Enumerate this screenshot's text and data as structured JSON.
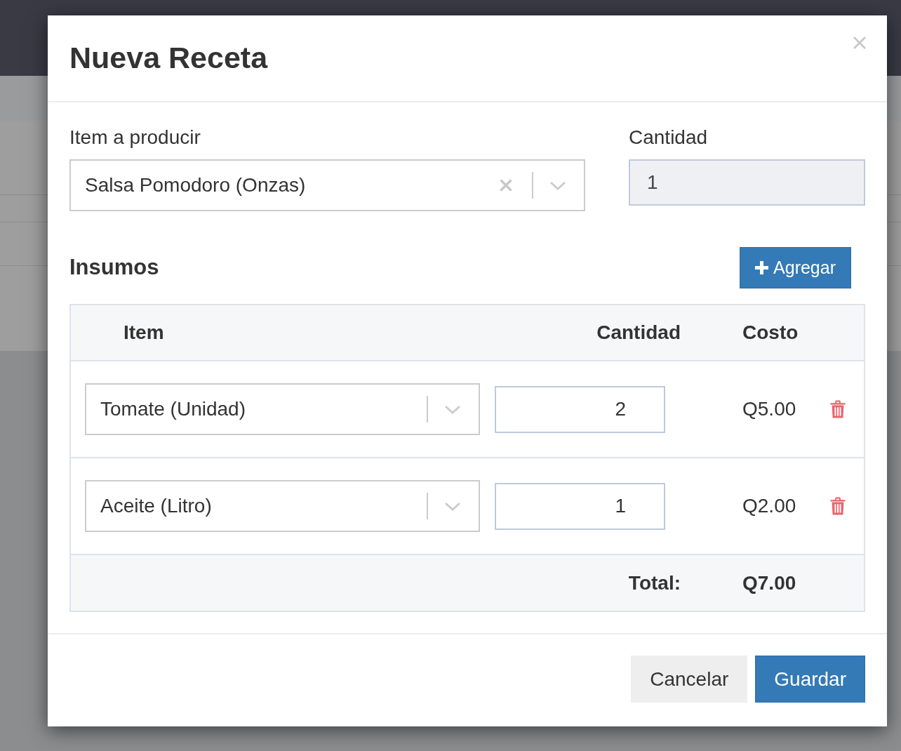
{
  "modal": {
    "title": "Nueva Receta"
  },
  "product": {
    "label": "Item a producir",
    "value": "Salsa Pomodoro (Onzas)",
    "clearable": true
  },
  "quantity": {
    "label": "Cantidad",
    "value": "1",
    "readonly": true
  },
  "ingredients": {
    "title": "Insumos",
    "add_button": "Agregar",
    "columns": [
      "Item",
      "Cantidad",
      "Costo"
    ],
    "rows": [
      {
        "item": "Tomate (Unidad)",
        "clearable": false,
        "quantity": "2",
        "cost": "Q5.00"
      },
      {
        "item": "Aceite (Litro)",
        "clearable": false,
        "quantity": "1",
        "cost": "Q2.00"
      }
    ],
    "total_label": "Total:",
    "total_value": "Q7.00"
  },
  "footer": {
    "buttons": [
      {
        "label": "Cancelar",
        "kind": "secondary"
      },
      {
        "label": "Guardar",
        "kind": "primary"
      }
    ]
  }
}
